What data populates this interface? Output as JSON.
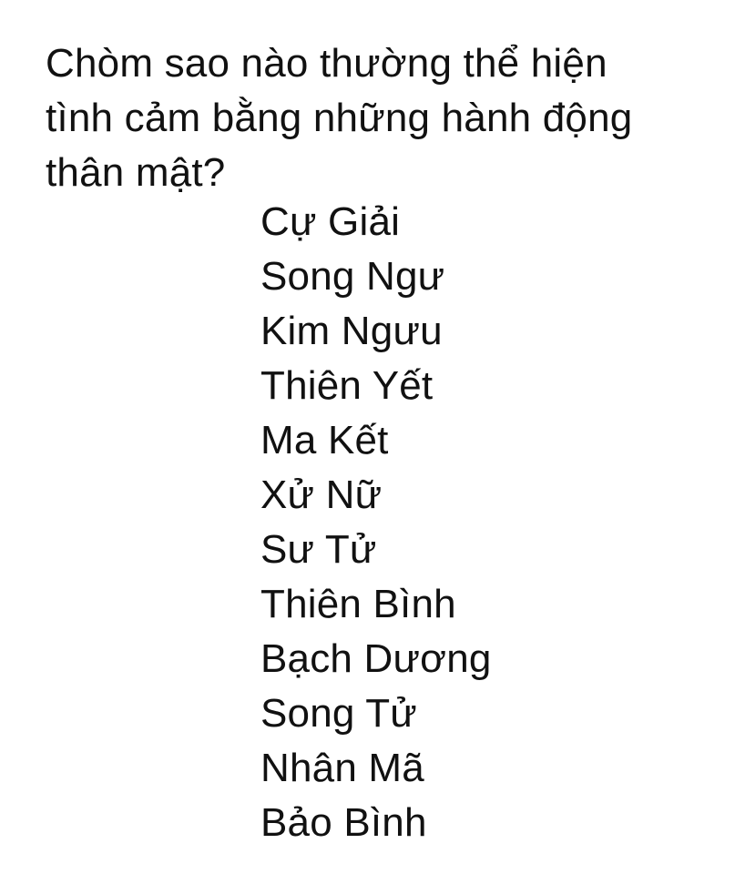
{
  "question": {
    "lines": [
      "Chòm sao nào thường thể hiện",
      "tình cảm bằng những hành động",
      "thân mật?"
    ]
  },
  "options": [
    "Cự Giải",
    "Song Ngư",
    "Kim Ngưu",
    "Thiên Yết",
    "Ma Kết",
    "Xử Nữ",
    "Sư Tử",
    "Thiên Bình",
    "Bạch Dương",
    "Song Tử",
    "Nhân Mã",
    "Bảo Bình"
  ]
}
